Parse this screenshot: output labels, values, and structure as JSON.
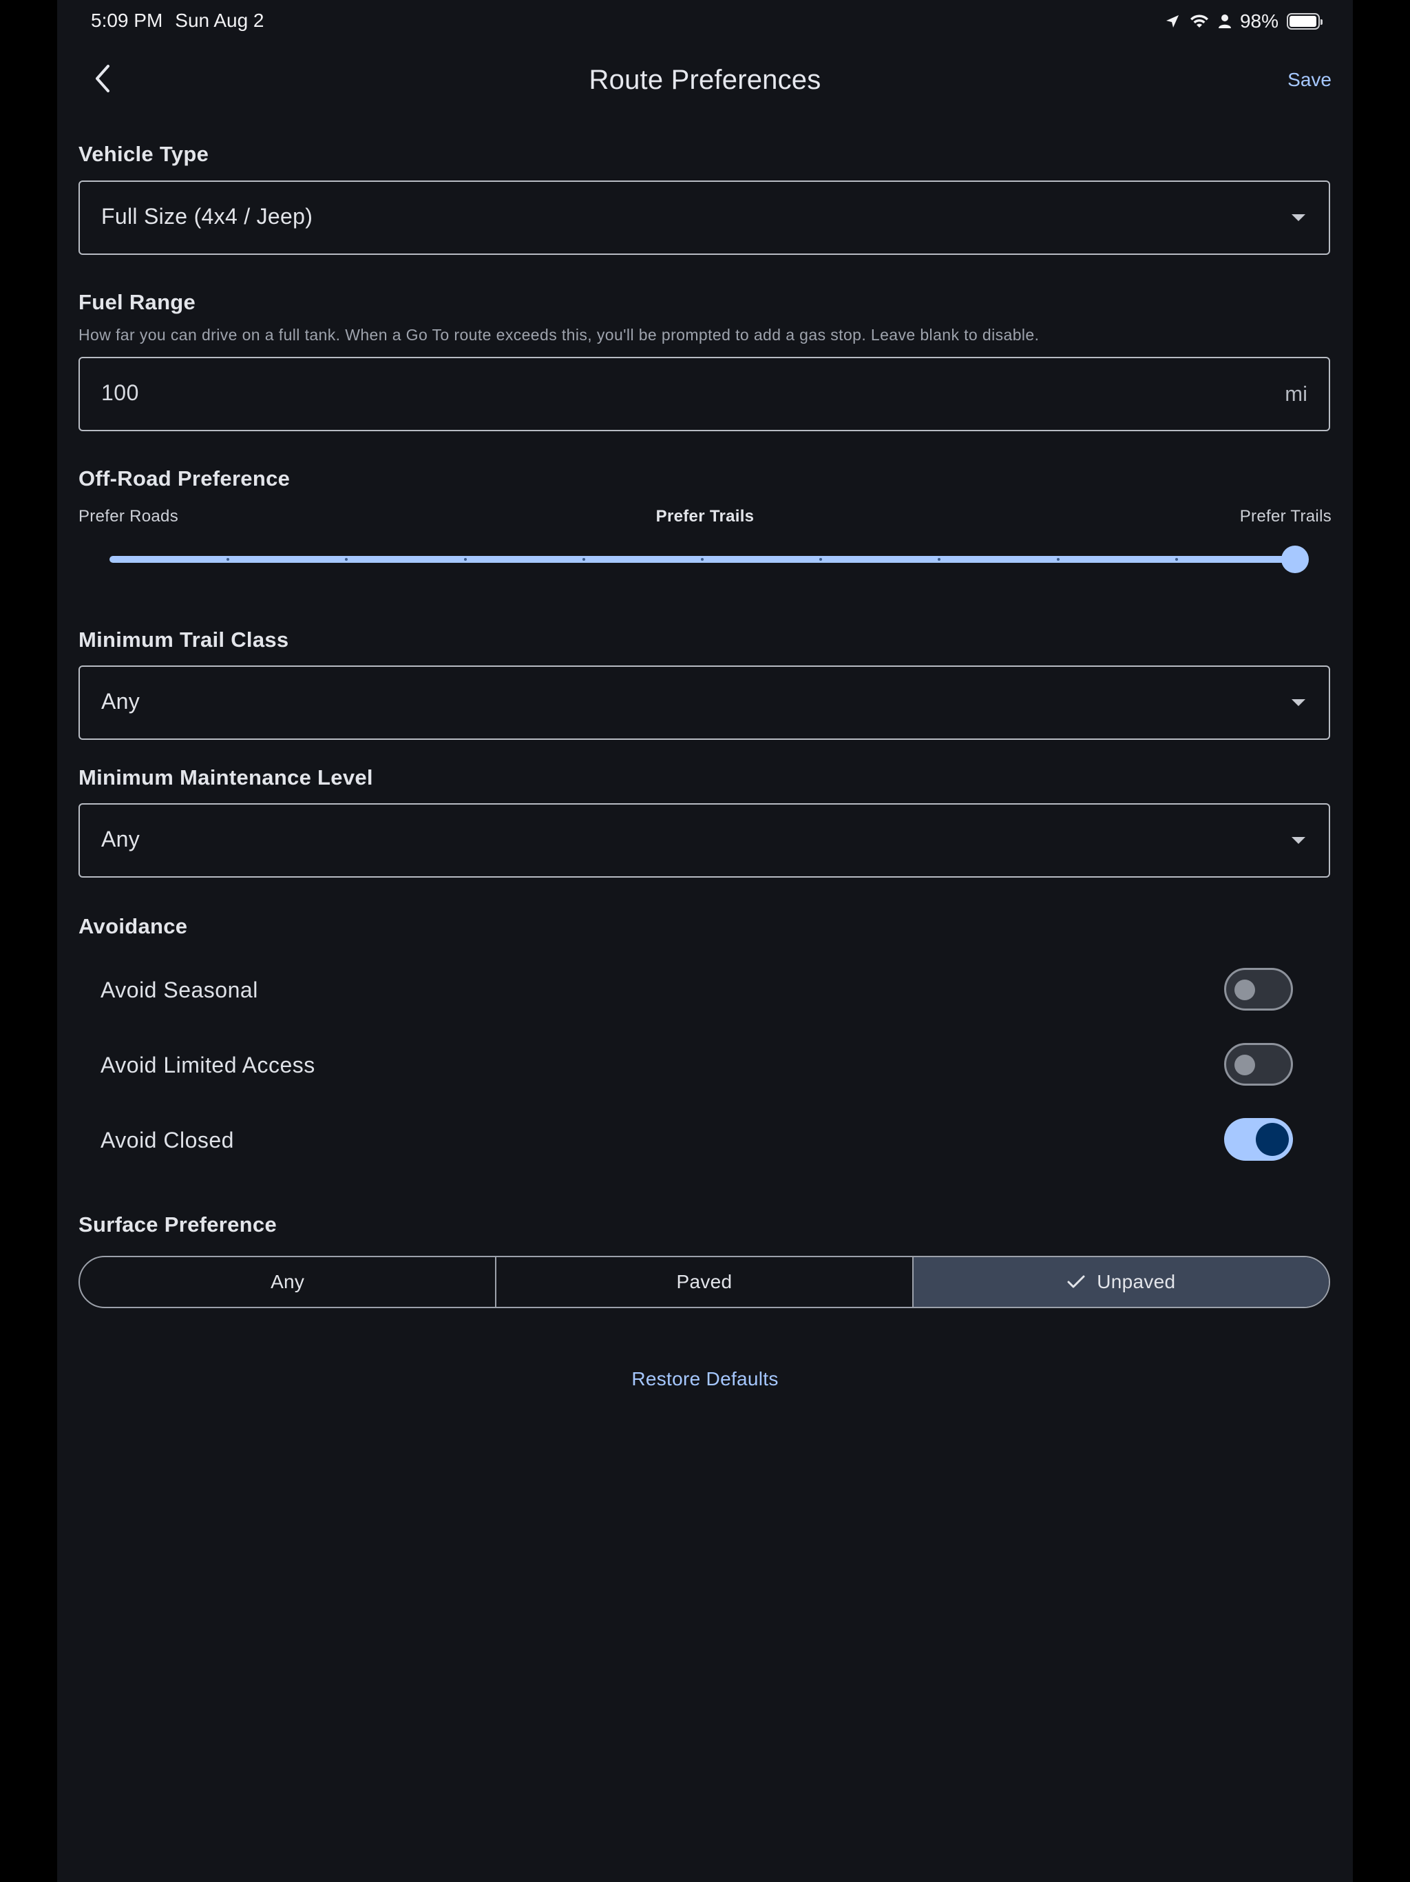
{
  "status_bar": {
    "time": "5:09 PM",
    "date": "Sun Aug 2",
    "battery_text": "98%",
    "battery_level": 0.98
  },
  "header": {
    "title": "Route Preferences",
    "save_label": "Save"
  },
  "vehicle_type": {
    "label": "Vehicle Type",
    "value": "Full Size (4x4 / Jeep)"
  },
  "fuel_range": {
    "label": "Fuel Range",
    "helper": "How far you can drive on a full tank. When a Go To route exceeds this, you'll be prompted to add a gas stop. Leave blank to disable.",
    "value": "100",
    "unit": "mi"
  },
  "off_road": {
    "label": "Off-Road Preference",
    "min_label": "Prefer Roads",
    "current_label": "Prefer Trails",
    "max_label": "Prefer Trails",
    "steps": 10,
    "value": 10
  },
  "trail_class": {
    "label": "Minimum Trail Class",
    "value": "Any"
  },
  "maintenance": {
    "label": "Minimum Maintenance Level",
    "value": "Any"
  },
  "avoidance": {
    "label": "Avoidance",
    "items": [
      {
        "label": "Avoid Seasonal",
        "enabled": false
      },
      {
        "label": "Avoid Limited Access",
        "enabled": false
      },
      {
        "label": "Avoid Closed",
        "enabled": true
      }
    ]
  },
  "surface": {
    "label": "Surface Preference",
    "options": [
      "Any",
      "Paved",
      "Unpaved"
    ],
    "selected": "Unpaved"
  },
  "restore_label": "Restore Defaults",
  "colors": {
    "accent": "#a6c8ff",
    "background": "#121419",
    "toggle_knob_on": "#003063",
    "segment_selected": "#3d4759"
  }
}
